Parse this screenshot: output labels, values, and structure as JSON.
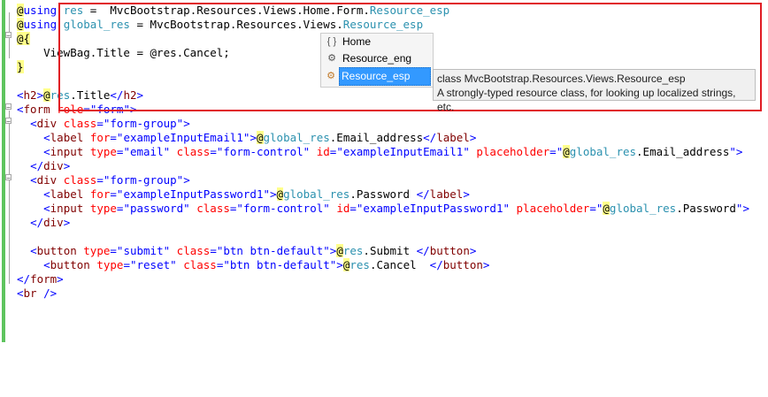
{
  "editor": {
    "lines": [
      [
        {
          "t": "@",
          "c": "at"
        },
        {
          "t": "using",
          "c": "kw"
        },
        {
          "t": " "
        },
        {
          "t": "res",
          "c": "teal"
        },
        {
          "t": " =  MvcBootstrap.Resources.Views.Home.Form."
        },
        {
          "t": "Resource_esp",
          "c": "teal"
        }
      ],
      [
        {
          "t": "@",
          "c": "at"
        },
        {
          "t": "using",
          "c": "kw"
        },
        {
          "t": " "
        },
        {
          "t": "global_res",
          "c": "teal"
        },
        {
          "t": " = MvcBootstrap.Resources.Views."
        },
        {
          "t": "Resource_esp",
          "c": "teal"
        }
      ],
      [
        {
          "t": "@{",
          "c": "at"
        }
      ],
      [
        {
          "t": "    ViewBag.Title = @res.Cancel;"
        }
      ],
      [
        {
          "t": "}",
          "c": "at"
        }
      ],
      [
        {
          "t": ""
        }
      ],
      [
        {
          "t": "<",
          "c": "val"
        },
        {
          "t": "h2",
          "c": "tag"
        },
        {
          "t": ">",
          "c": "val"
        },
        {
          "t": "@",
          "c": "at"
        },
        {
          "t": "res",
          "c": "teal"
        },
        {
          "t": ".Title"
        },
        {
          "t": "</",
          "c": "val"
        },
        {
          "t": "h2",
          "c": "tag"
        },
        {
          "t": ">",
          "c": "val"
        }
      ],
      [
        {
          "t": "<",
          "c": "val"
        },
        {
          "t": "form",
          "c": "tag"
        },
        {
          "t": " "
        },
        {
          "t": "role",
          "c": "attr"
        },
        {
          "t": "=",
          "c": "val"
        },
        {
          "t": "\"form\"",
          "c": "val"
        },
        {
          "t": ">",
          "c": "val"
        }
      ],
      [
        {
          "t": "  "
        },
        {
          "t": "<",
          "c": "val"
        },
        {
          "t": "div",
          "c": "tag"
        },
        {
          "t": " "
        },
        {
          "t": "class",
          "c": "attr"
        },
        {
          "t": "=",
          "c": "val"
        },
        {
          "t": "\"form-group\"",
          "c": "val"
        },
        {
          "t": ">",
          "c": "val"
        }
      ],
      [
        {
          "t": "    "
        },
        {
          "t": "<",
          "c": "val"
        },
        {
          "t": "label",
          "c": "tag"
        },
        {
          "t": " "
        },
        {
          "t": "for",
          "c": "attr"
        },
        {
          "t": "=",
          "c": "val"
        },
        {
          "t": "\"exampleInputEmail1\"",
          "c": "val"
        },
        {
          "t": ">",
          "c": "val"
        },
        {
          "t": "@",
          "c": "at"
        },
        {
          "t": "global_res",
          "c": "teal"
        },
        {
          "t": ".Email_address"
        },
        {
          "t": "</",
          "c": "val"
        },
        {
          "t": "label",
          "c": "tag"
        },
        {
          "t": ">",
          "c": "val"
        }
      ],
      [
        {
          "t": "    "
        },
        {
          "t": "<",
          "c": "val"
        },
        {
          "t": "input",
          "c": "tag"
        },
        {
          "t": " "
        },
        {
          "t": "type",
          "c": "attr"
        },
        {
          "t": "=",
          "c": "val"
        },
        {
          "t": "\"email\"",
          "c": "val"
        },
        {
          "t": " "
        },
        {
          "t": "class",
          "c": "attr"
        },
        {
          "t": "=",
          "c": "val"
        },
        {
          "t": "\"form-control\"",
          "c": "val"
        },
        {
          "t": " "
        },
        {
          "t": "id",
          "c": "attr"
        },
        {
          "t": "=",
          "c": "val"
        },
        {
          "t": "\"exampleInputEmail1\"",
          "c": "val"
        },
        {
          "t": " "
        },
        {
          "t": "placeholder",
          "c": "attr"
        },
        {
          "t": "=",
          "c": "val"
        },
        {
          "t": "\"",
          "c": "val"
        },
        {
          "t": "@",
          "c": "at"
        },
        {
          "t": "global_res",
          "c": "teal"
        },
        {
          "t": ".Email_address"
        },
        {
          "t": "\"",
          "c": "val"
        },
        {
          "t": ">",
          "c": "val"
        }
      ],
      [
        {
          "t": "  "
        },
        {
          "t": "</",
          "c": "val"
        },
        {
          "t": "div",
          "c": "tag"
        },
        {
          "t": ">",
          "c": "val"
        }
      ],
      [
        {
          "t": "  "
        },
        {
          "t": "<",
          "c": "val"
        },
        {
          "t": "div",
          "c": "tag"
        },
        {
          "t": " "
        },
        {
          "t": "class",
          "c": "attr"
        },
        {
          "t": "=",
          "c": "val"
        },
        {
          "t": "\"form-group\"",
          "c": "val"
        },
        {
          "t": ">",
          "c": "val"
        }
      ],
      [
        {
          "t": "    "
        },
        {
          "t": "<",
          "c": "val"
        },
        {
          "t": "label",
          "c": "tag"
        },
        {
          "t": " "
        },
        {
          "t": "for",
          "c": "attr"
        },
        {
          "t": "=",
          "c": "val"
        },
        {
          "t": "\"exampleInputPassword1\"",
          "c": "val"
        },
        {
          "t": ">",
          "c": "val"
        },
        {
          "t": "@",
          "c": "at"
        },
        {
          "t": "global_res",
          "c": "teal"
        },
        {
          "t": ".Password "
        },
        {
          "t": "</",
          "c": "val"
        },
        {
          "t": "label",
          "c": "tag"
        },
        {
          "t": ">",
          "c": "val"
        }
      ],
      [
        {
          "t": "    "
        },
        {
          "t": "<",
          "c": "val"
        },
        {
          "t": "input",
          "c": "tag"
        },
        {
          "t": " "
        },
        {
          "t": "type",
          "c": "attr"
        },
        {
          "t": "=",
          "c": "val"
        },
        {
          "t": "\"password\"",
          "c": "val"
        },
        {
          "t": " "
        },
        {
          "t": "class",
          "c": "attr"
        },
        {
          "t": "=",
          "c": "val"
        },
        {
          "t": "\"form-control\"",
          "c": "val"
        },
        {
          "t": " "
        },
        {
          "t": "id",
          "c": "attr"
        },
        {
          "t": "=",
          "c": "val"
        },
        {
          "t": "\"exampleInputPassword1\"",
          "c": "val"
        },
        {
          "t": " "
        },
        {
          "t": "placeholder",
          "c": "attr"
        },
        {
          "t": "=",
          "c": "val"
        },
        {
          "t": "\"",
          "c": "val"
        },
        {
          "t": "@",
          "c": "at"
        },
        {
          "t": "global_res",
          "c": "teal"
        },
        {
          "t": ".Password"
        },
        {
          "t": "\"",
          "c": "val"
        },
        {
          "t": ">",
          "c": "val"
        }
      ],
      [
        {
          "t": "  "
        },
        {
          "t": "</",
          "c": "val"
        },
        {
          "t": "div",
          "c": "tag"
        },
        {
          "t": ">",
          "c": "val"
        }
      ],
      [
        {
          "t": ""
        }
      ],
      [
        {
          "t": "  "
        },
        {
          "t": "<",
          "c": "val"
        },
        {
          "t": "button",
          "c": "tag"
        },
        {
          "t": " "
        },
        {
          "t": "type",
          "c": "attr"
        },
        {
          "t": "=",
          "c": "val"
        },
        {
          "t": "\"submit\"",
          "c": "val"
        },
        {
          "t": " "
        },
        {
          "t": "class",
          "c": "attr"
        },
        {
          "t": "=",
          "c": "val"
        },
        {
          "t": "\"btn btn-default\"",
          "c": "val"
        },
        {
          "t": ">",
          "c": "val"
        },
        {
          "t": "@",
          "c": "at"
        },
        {
          "t": "res",
          "c": "teal"
        },
        {
          "t": ".Submit "
        },
        {
          "t": "</",
          "c": "val"
        },
        {
          "t": "button",
          "c": "tag"
        },
        {
          "t": ">",
          "c": "val"
        }
      ],
      [
        {
          "t": "    "
        },
        {
          "t": "<",
          "c": "val"
        },
        {
          "t": "button",
          "c": "tag"
        },
        {
          "t": " "
        },
        {
          "t": "type",
          "c": "attr"
        },
        {
          "t": "=",
          "c": "val"
        },
        {
          "t": "\"reset\"",
          "c": "val"
        },
        {
          "t": " "
        },
        {
          "t": "class",
          "c": "attr"
        },
        {
          "t": "=",
          "c": "val"
        },
        {
          "t": "\"btn btn-default\"",
          "c": "val"
        },
        {
          "t": ">",
          "c": "val"
        },
        {
          "t": "@",
          "c": "at"
        },
        {
          "t": "res",
          "c": "teal"
        },
        {
          "t": ".Cancel  "
        },
        {
          "t": "</",
          "c": "val"
        },
        {
          "t": "button",
          "c": "tag"
        },
        {
          "t": ">",
          "c": "val"
        }
      ],
      [
        {
          "t": "</",
          "c": "val"
        },
        {
          "t": "form",
          "c": "tag"
        },
        {
          "t": ">",
          "c": "val"
        }
      ],
      [
        {
          "t": "<",
          "c": "val"
        },
        {
          "t": "br",
          "c": "tag"
        },
        {
          "t": " />",
          "c": "val"
        }
      ]
    ]
  },
  "intellisense": {
    "items": [
      {
        "label": "Home",
        "icon": "namespace-icon",
        "glyph": "{ }"
      },
      {
        "label": "Resource_eng",
        "icon": "class-icon",
        "glyph": "⚙"
      },
      {
        "label": "Resource_esp",
        "icon": "class-icon",
        "glyph": "⚙"
      }
    ],
    "selected_index": 2
  },
  "tooltip": {
    "line1": "class MvcBootstrap.Resources.Views.Resource_esp",
    "line2": "A strongly-typed resource class, for looking up localized strings, etc."
  },
  "colors": {
    "highlight_box": "#e01b24",
    "change_bar": "#5ec45e",
    "selection": "#3399ff"
  }
}
